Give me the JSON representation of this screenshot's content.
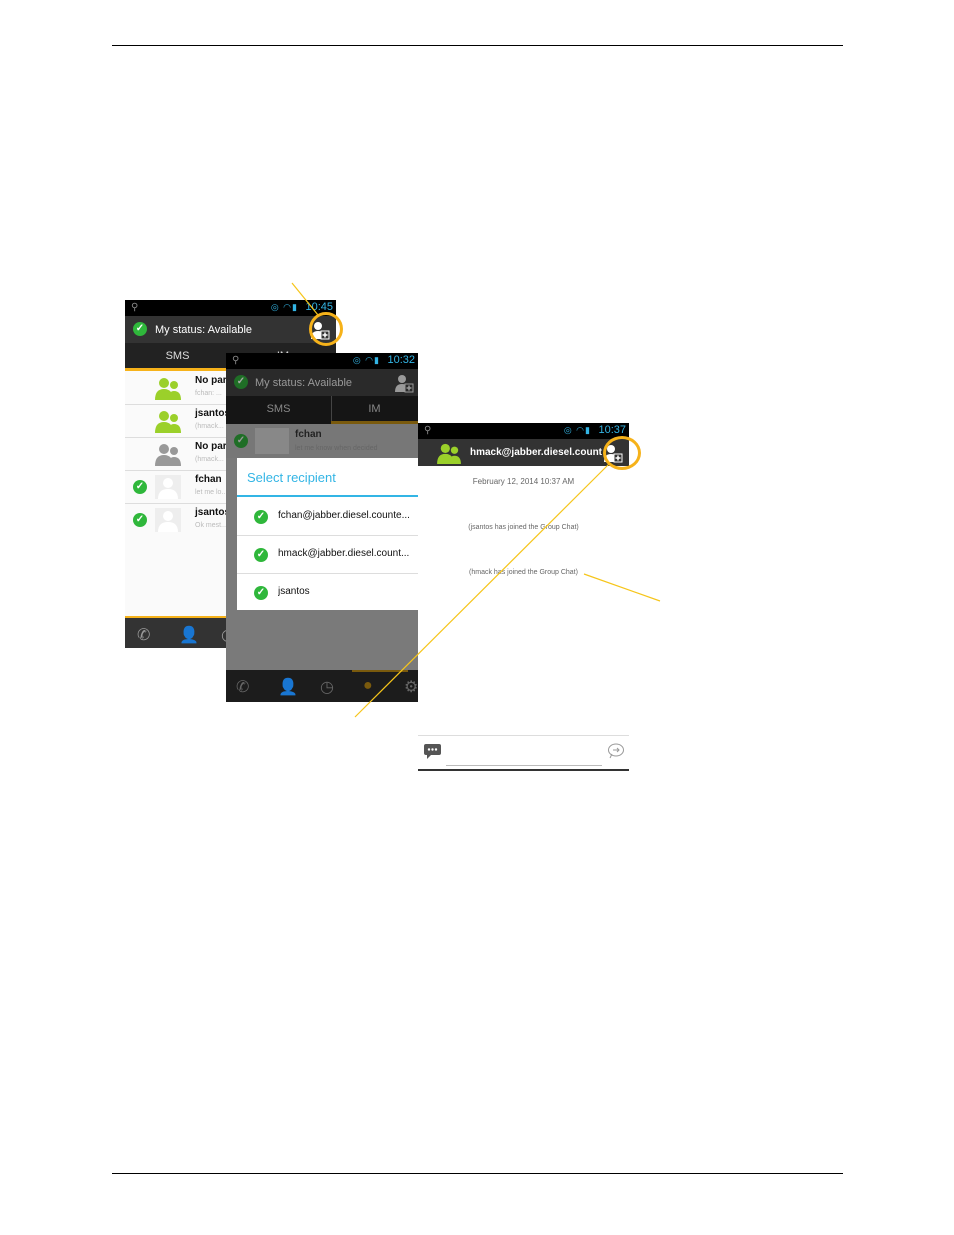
{
  "screen1": {
    "time": "10:45",
    "status": "My status: Available",
    "tabs": [
      "SMS",
      "IM"
    ],
    "rows": [
      {
        "name": "No par",
        "sub": "fchan: ..."
      },
      {
        "name": "jsantos",
        "sub": "(hmack..."
      },
      {
        "name": "No par",
        "sub": "(hmack..."
      },
      {
        "name": "fchan",
        "sub": "let me lo..."
      },
      {
        "name": "jsantos",
        "sub": "Ok mest..."
      }
    ]
  },
  "screen2": {
    "time": "10:32",
    "status": "My status: Available",
    "tabs": [
      "SMS",
      "IM"
    ],
    "row": {
      "name": "fchan",
      "sub": "let me know when decided"
    },
    "dialog": {
      "title": "Select recipient",
      "items": [
        "fchan@jabber.diesel.counte...",
        "hmack@jabber.diesel.count...",
        "jsantos"
      ]
    }
  },
  "screen3": {
    "time": "10:37",
    "title": "hmack@jabber.diesel.count",
    "date": "February 12, 2014 10:37 AM",
    "messages": [
      "(jsantos has joined the Group Chat)",
      "(hmack has joined the Group Chat)"
    ]
  },
  "colors": {
    "accent": "#f6b21a",
    "online": "#2fb73b",
    "holo_blue": "#33b5e5"
  }
}
